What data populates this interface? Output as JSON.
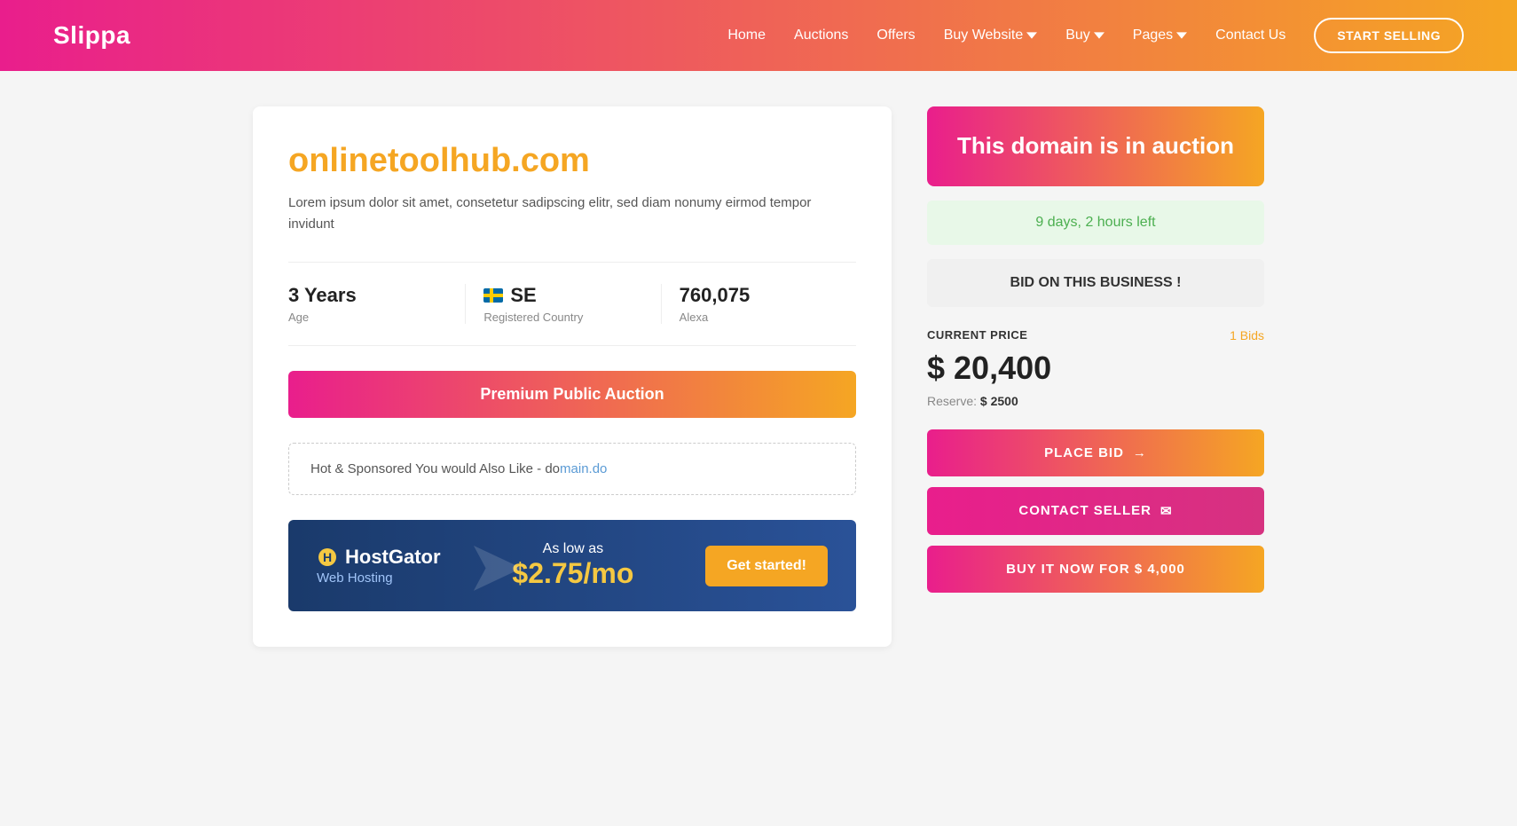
{
  "header": {
    "logo": "Slippa",
    "nav": {
      "home": "Home",
      "auctions": "Auctions",
      "offers": "Offers",
      "buy_website": "Buy Website",
      "buy": "Buy",
      "pages": "Pages",
      "contact_us": "Contact Us"
    },
    "start_selling": "START SELLING"
  },
  "main": {
    "left": {
      "domain_name": "onlinetoolhub.com",
      "description_text": "Lorem ipsum dolor sit amet, consetetur sadipscing elitr, sed diam nonumy eirmod tempor invidunt",
      "stats": {
        "age_value": "3 Years",
        "age_label": "Age",
        "country_code": "SE",
        "country_label": "Registered Country",
        "alexa_value": "760,075",
        "alexa_label": "Alexa"
      },
      "auction_banner": "Premium Public Auction",
      "sponsored_text": "Hot & Sponsored You would Also Like - do",
      "hostgator": {
        "logo_text": "HostGator",
        "sub_text": "Web Hosting",
        "as_low": "As low as",
        "price": "$2.75/mo",
        "cta": "Get started!"
      }
    },
    "right": {
      "auction_badge": "This domain is in auction",
      "time_left": "9 days, 2 hours left",
      "bid_business_btn": "BID ON THIS BUSINESS !",
      "current_price_label": "CURRENT PRICE",
      "bids_count": "1 Bids",
      "current_price": "$ 20,400",
      "reserve_label": "Reserve:",
      "reserve_price": "$ 2500",
      "place_bid_btn": "PLACE BID",
      "contact_seller_btn": "CONTACT SELLER",
      "buy_now_btn": "BUY IT NOW FOR $ 4,000"
    }
  }
}
